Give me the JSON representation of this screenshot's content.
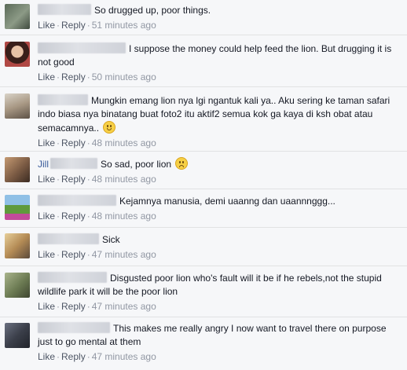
{
  "actions": {
    "like": "Like",
    "reply": "Reply",
    "separator": "·"
  },
  "comments": [
    {
      "text": "So drugged up, poor things.",
      "time": "51 minutes ago",
      "avatar_color": "#6d7b6a"
    },
    {
      "text": "I suppose the money could help feed the lion. But drugging it is not good",
      "time": "50 minutes ago",
      "avatar_color": "#c0504a"
    },
    {
      "text": "Mungkin emang lion nya lgi ngantuk kali ya.. Aku sering ke taman safari indo biasa nya binatang buat foto2 itu aktif2 semua kok ga kaya di ksh obat atau semacamnya..",
      "time": "48 minutes ago",
      "avatar_color": "#9a8f80",
      "emoji": "smile-emoji"
    },
    {
      "name_fragment": "Jill",
      "text": "So sad, poor lion",
      "time": "48 minutes ago",
      "avatar_color": "#8a6c55",
      "emoji": "sad-emoji"
    },
    {
      "text": "Kejamnya manusia, demi uaanng dan uaannnggg...",
      "time": "48 minutes ago",
      "avatar_color": "#6fa14a"
    },
    {
      "text": "Sick",
      "time": "47 minutes ago",
      "avatar_color": "#c9a66b"
    },
    {
      "text": "Disgusted poor lion who's fault will it be if he rebels,not the stupid wildlife park it will be the poor lion",
      "time": "47 minutes ago",
      "avatar_color": "#7a8a5c"
    },
    {
      "text": "This makes me really angry I now want to travel there on purpose just to go mental at them",
      "time": "47 minutes ago",
      "avatar_color": "#4a4f5c"
    }
  ]
}
